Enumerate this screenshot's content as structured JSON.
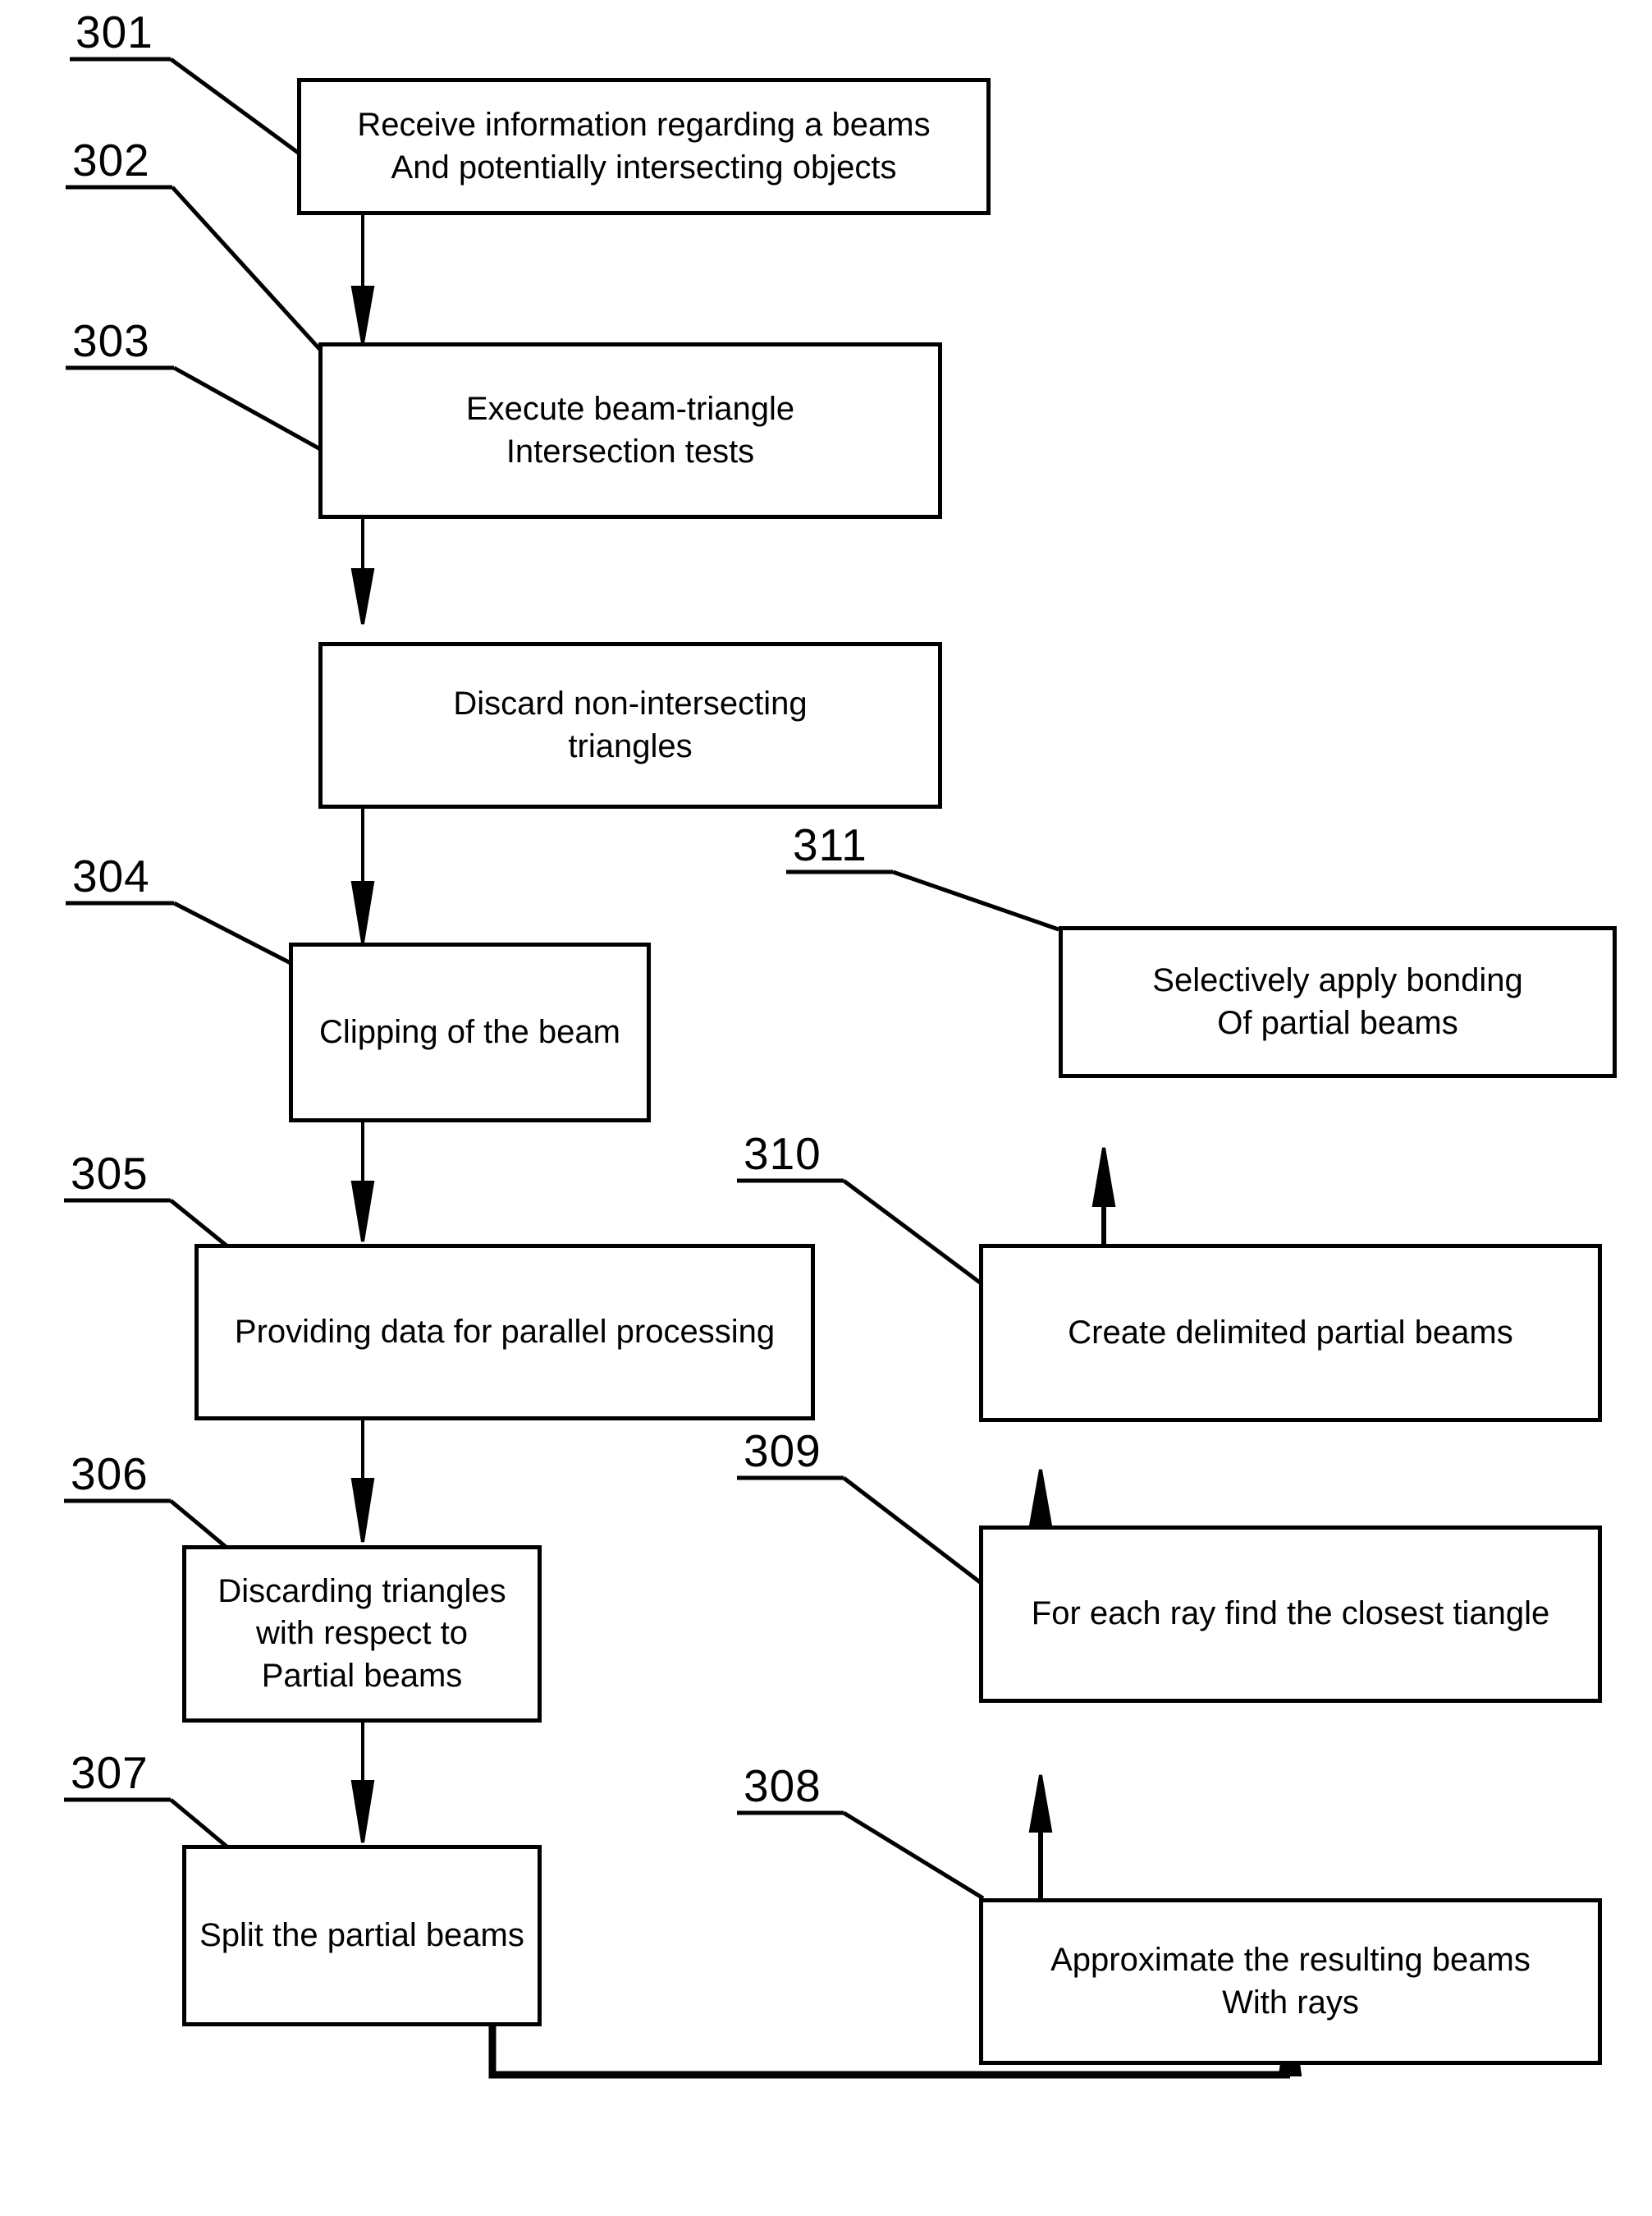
{
  "figure": {
    "type": "patent-flowchart",
    "background_color": "#ffffff",
    "line_color": "#000000"
  },
  "nodes": [
    {
      "ref": "301",
      "label": "Receive information regarding a beams\nAnd potentially intersecting objects"
    },
    {
      "ref": "302",
      "label": "Execute beam-triangle\nIntersection tests"
    },
    {
      "ref": "303",
      "label": "Discard non-intersecting\ntriangles"
    },
    {
      "ref": "304",
      "label": "Clipping of the beam"
    },
    {
      "ref": "305",
      "label": "Providing data for parallel processing"
    },
    {
      "ref": "306",
      "label": "Discarding triangles with respect to\nPartial beams"
    },
    {
      "ref": "307",
      "label": "Split the partial beams"
    },
    {
      "ref": "308",
      "label": "Approximate the resulting beams\nWith rays"
    },
    {
      "ref": "309",
      "label": "For each ray find the closest tiangle"
    },
    {
      "ref": "310",
      "label": "Create delimited partial beams"
    },
    {
      "ref": "311",
      "label": "Selectively apply bonding\nOf partial beams"
    }
  ],
  "ref_numbers": {
    "n301": "301",
    "n302": "302",
    "n303": "303",
    "n304": "304",
    "n305": "305",
    "n306": "306",
    "n307": "307",
    "n308": "308",
    "n309": "309",
    "n310": "310",
    "n311": "311"
  },
  "node_text": {
    "t301": "Receive information regarding a beams\nAnd potentially intersecting objects",
    "t302": "Execute beam-triangle\nIntersection tests",
    "t303": "Discard non-intersecting\ntriangles",
    "t304": "Clipping of the beam",
    "t305": "Providing data for parallel processing",
    "t306": "Discarding triangles with respect to\nPartial beams",
    "t307": "Split the partial beams",
    "t308": "Approximate the resulting beams\nWith rays",
    "t309": "For each ray find the closest tiangle",
    "t310": "Create delimited partial beams",
    "t311": "Selectively apply bonding\nOf partial beams"
  },
  "edges": [
    {
      "from": "301",
      "to": "302",
      "direction": "down"
    },
    {
      "from": "302",
      "to": "303",
      "direction": "down"
    },
    {
      "from": "303",
      "to": "304",
      "direction": "down"
    },
    {
      "from": "304",
      "to": "305",
      "direction": "down"
    },
    {
      "from": "305",
      "to": "306",
      "direction": "down"
    },
    {
      "from": "306",
      "to": "307",
      "direction": "down"
    },
    {
      "from": "307",
      "to": "308",
      "direction": "loop-right-up"
    },
    {
      "from": "308",
      "to": "309",
      "direction": "up"
    },
    {
      "from": "309",
      "to": "310",
      "direction": "up"
    },
    {
      "from": "310",
      "to": "311",
      "direction": "up"
    }
  ]
}
